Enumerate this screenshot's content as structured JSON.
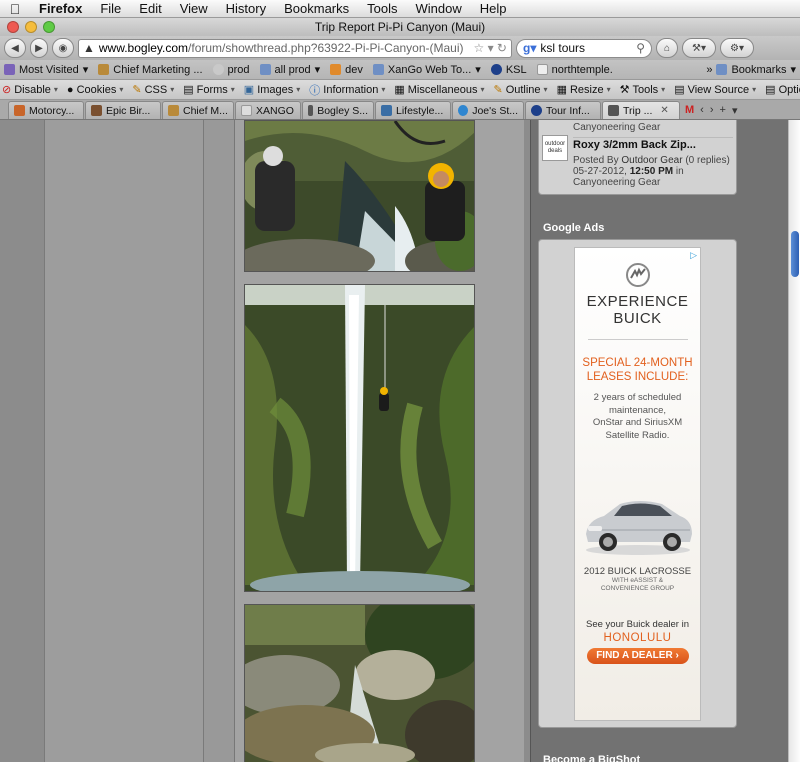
{
  "menubar": {
    "app": "Firefox",
    "items": [
      "File",
      "Edit",
      "View",
      "History",
      "Bookmarks",
      "Tools",
      "Window",
      "Help"
    ]
  },
  "window": {
    "title": "Trip Report Pi-Pi Canyon (Maui)"
  },
  "navbar": {
    "url_host": "www.bogley.com",
    "url_path": "/forum/showthread.php?63922-Pi-Pi-Canyon-(Maui)",
    "search_value": "ksl tours"
  },
  "bookmarks": [
    "Most Visited",
    "Chief Marketing ...",
    "prod",
    "all prod",
    "dev",
    "XanGo Web To...",
    "KSL",
    "northtemple."
  ],
  "bookmarks_more": "Bookmarks",
  "devtoolbar": [
    "Disable",
    "Cookies",
    "CSS",
    "Forms",
    "Images",
    "Information",
    "Miscellaneous",
    "Outline",
    "Resize",
    "Tools",
    "View Source",
    "Options"
  ],
  "tabs": [
    "Motorcy...",
    "Epic Bir...",
    "Chief M...",
    "XANGO",
    "Bogley S...",
    "Lifestyle...",
    "Joe's St...",
    "Tour Inf...",
    "Trip ..."
  ],
  "sidebar": {
    "prev_link": "Canyoneering Gear",
    "post": {
      "logo_text": "outdoor deals",
      "title": "Roxy 3/2mm Back Zip...",
      "posted_by_prefix": "Posted By",
      "author": "Outdoor Gear",
      "replies": "(0 replies)",
      "date": "05-27-2012,",
      "time": "12:50 PM",
      "in_word": "in",
      "forum": "Canyoneering Gear"
    },
    "ads_title": "Google Ads",
    "next_title": "Become a BigShot"
  },
  "ad": {
    "headline1": "EXPERIENCE",
    "headline2": "BUICK",
    "offer1": "SPECIAL 24-MONTH",
    "offer2": "LEASES INCLUDE:",
    "body1": "2 years of scheduled",
    "body2": "maintenance,",
    "body3": "OnStar and SiriusXM",
    "body4": "Satellite Radio.",
    "model": "2012 BUICK LACROSSE",
    "model_sub1": "WITH eASSIST &",
    "model_sub2": "CONVENIENCE GROUP",
    "cta_text": "See your Buick dealer in",
    "city": "HONOLULU",
    "button": "FIND A DEALER ›",
    "brand_color": "#e2601e"
  }
}
